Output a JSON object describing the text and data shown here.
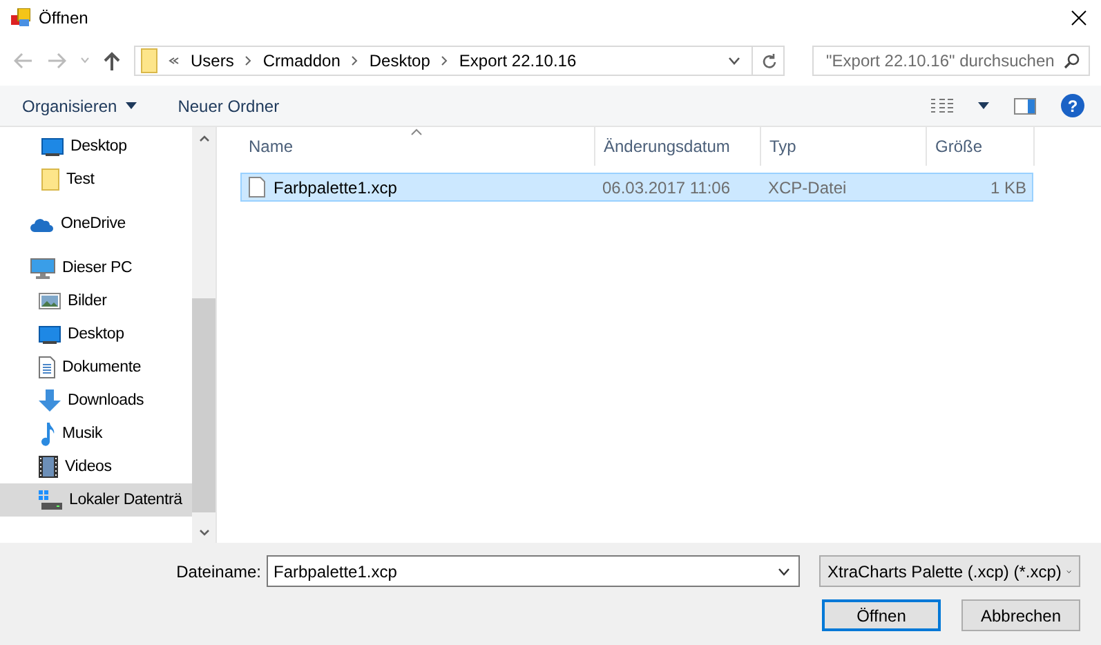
{
  "window": {
    "title": "Öffnen"
  },
  "address": {
    "segments": [
      "Users",
      "Crmaddon",
      "Desktop",
      "Export 22.10.16"
    ]
  },
  "search": {
    "placeholder": "\"Export 22.10.16\" durchsuchen"
  },
  "toolbar": {
    "organize": "Organisieren",
    "new_folder": "Neuer Ordner",
    "help": "?"
  },
  "sidebar": {
    "items": [
      {
        "label": "Desktop",
        "kind": "desktop",
        "selected": false
      },
      {
        "label": "Test",
        "kind": "folder",
        "selected": false
      },
      {
        "label": "OneDrive",
        "kind": "cloud",
        "selected": false
      },
      {
        "label": "Dieser PC",
        "kind": "pc",
        "selected": false,
        "children": [
          {
            "label": "Bilder",
            "kind": "pictures",
            "selected": false
          },
          {
            "label": "Desktop",
            "kind": "desktop",
            "selected": false
          },
          {
            "label": "Dokumente",
            "kind": "document",
            "selected": false
          },
          {
            "label": "Downloads",
            "kind": "download",
            "selected": false
          },
          {
            "label": "Musik",
            "kind": "music",
            "selected": false
          },
          {
            "label": "Videos",
            "kind": "video",
            "selected": false
          },
          {
            "label": "Lokaler Datenträ",
            "kind": "drive",
            "selected": true
          }
        ]
      }
    ]
  },
  "file_list": {
    "columns": [
      {
        "label": "Name",
        "sorted": true
      },
      {
        "label": "Änderungsdatum",
        "sorted": false
      },
      {
        "label": "Typ",
        "sorted": false
      },
      {
        "label": "Größe",
        "sorted": false
      }
    ],
    "rows": [
      {
        "name": "Farbpalette1.xcp",
        "modified": "06.03.2017 11:06",
        "type": "XCP-Datei",
        "size": "1 KB",
        "selected": true
      }
    ]
  },
  "footer": {
    "filename_label": "Dateiname:",
    "filename_value": "Farbpalette1.xcp",
    "filter": "XtraCharts Palette (.xcp) (*.xcp)",
    "open": "Öffnen",
    "cancel": "Abbrechen"
  }
}
